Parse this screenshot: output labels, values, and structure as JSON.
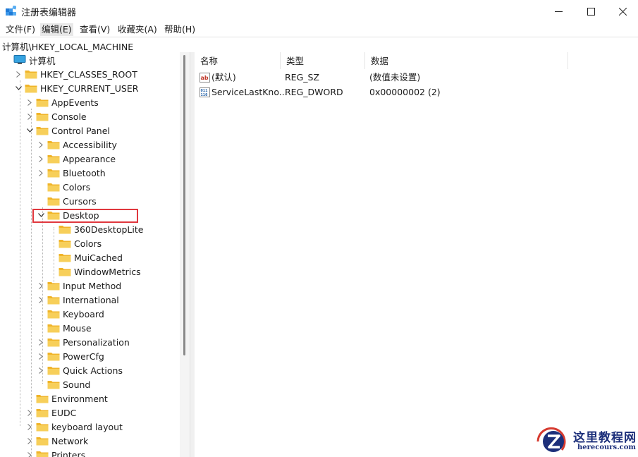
{
  "window": {
    "title": "注册表编辑器"
  },
  "menu": [
    "文件(F)",
    "编辑(E)",
    "查看(V)",
    "收藏夹(A)",
    "帮助(H)"
  ],
  "address": "计算机\\HKEY_LOCAL_MACHINE",
  "tree": {
    "root": "计算机",
    "nodes": [
      "HKEY_CLASSES_ROOT",
      "HKEY_CURRENT_USER",
      "AppEvents",
      "Console",
      "Control Panel",
      "Accessibility",
      "Appearance",
      "Bluetooth",
      "Colors",
      "Cursors",
      "Desktop",
      "360DesktopLite",
      "Colors",
      "MuiCached",
      "WindowMetrics",
      "Input Method",
      "International",
      "Keyboard",
      "Mouse",
      "Personalization",
      "PowerCfg",
      "Quick Actions",
      "Sound",
      "Environment",
      "EUDC",
      "keyboard layout",
      "Network",
      "Printers"
    ]
  },
  "list": {
    "columns": [
      "名称",
      "类型",
      "数据"
    ],
    "rows": [
      {
        "name": "(默认)",
        "type": "REG_SZ",
        "data": "(数值未设置)",
        "icon": "string-value-icon"
      },
      {
        "name": "ServiceLastKno...",
        "type": "REG_DWORD",
        "data": "0x00000002 (2)",
        "icon": "binary-value-icon"
      }
    ]
  },
  "watermark": {
    "cn": "这里教程网",
    "en": "herecours.com"
  },
  "colors": {
    "folder": "#f5c542",
    "highlight": "#e0383e",
    "watermark": "#1c2f7a"
  }
}
